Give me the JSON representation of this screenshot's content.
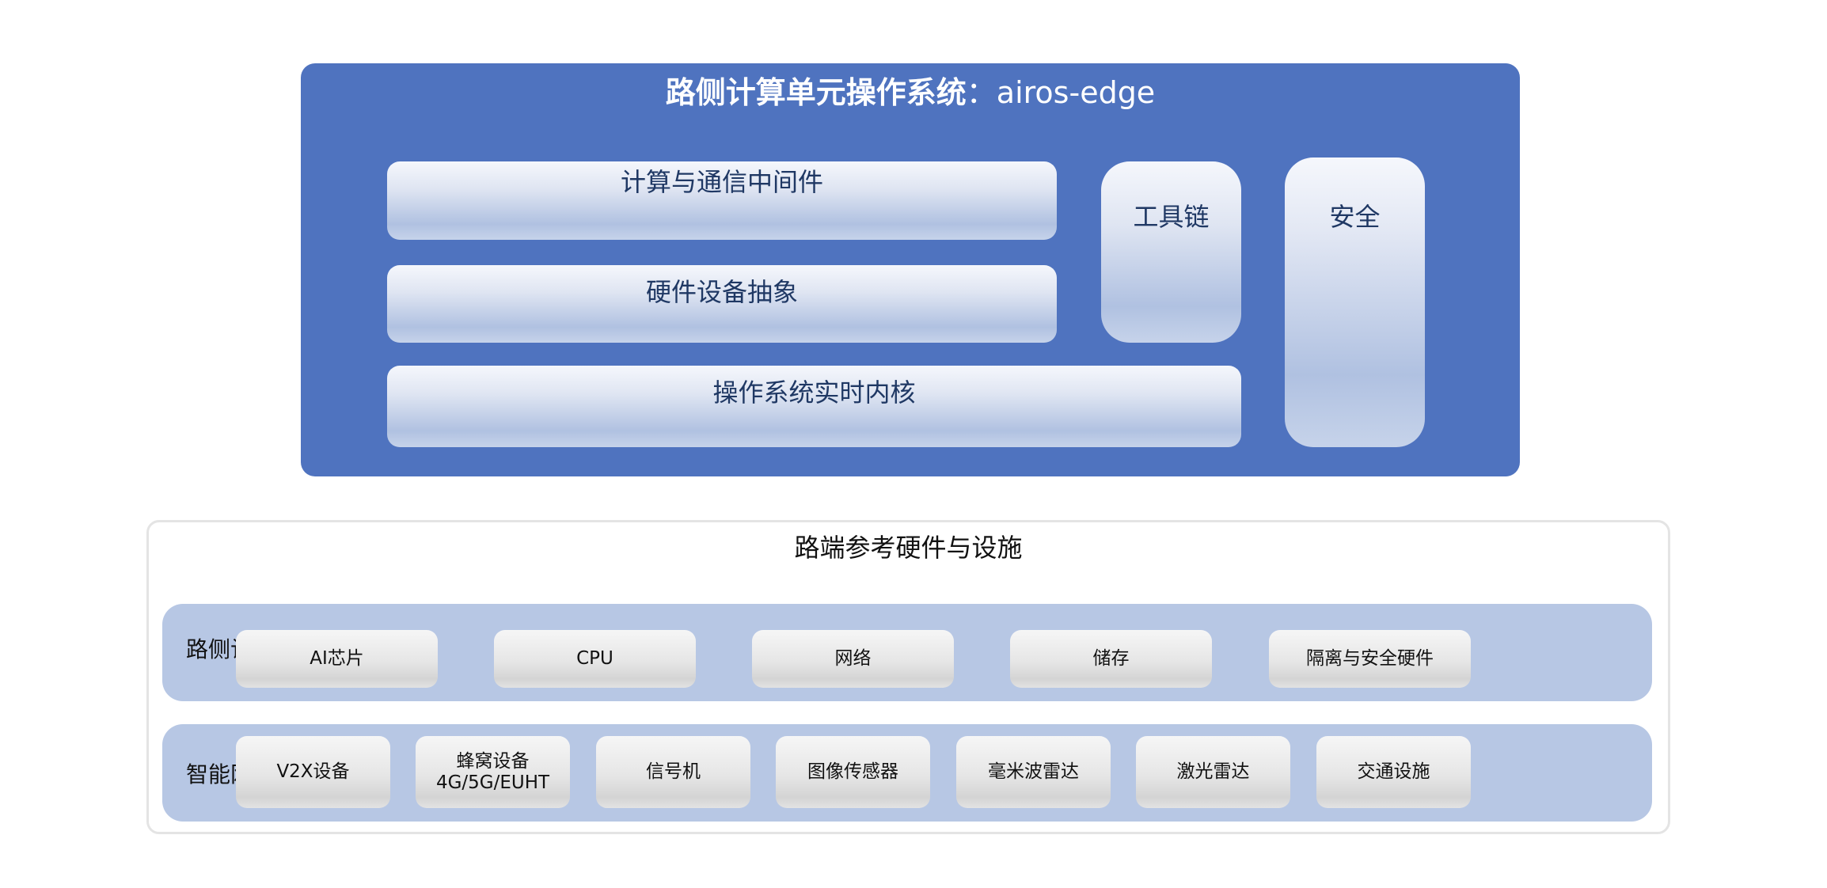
{
  "os": {
    "title_bold": "路侧计算单元操作系统",
    "title_rest": "：airos-edge",
    "colors": {
      "panel": "#4f73bf",
      "text": "#1f3864"
    },
    "modules": {
      "middleware": "计算与通信中间件",
      "hw_abstraction": "硬件设备抽象",
      "kernel": "操作系统实时内核",
      "toolchain": "工具链",
      "security": "安全"
    }
  },
  "hardware": {
    "title": "路端参考硬件与设施",
    "colors": {
      "row": "#b7c7e4",
      "border": "#e4e4e4"
    },
    "rows": [
      {
        "label": "路侧计算单元",
        "items": [
          "AI芯片",
          "CPU",
          "网络",
          "储存",
          "隔离与安全硬件"
        ]
      },
      {
        "label": "智能网联设备",
        "items": [
          "V2X设备",
          "蜂窝设备\n4G/5G/EUHT",
          "信号机",
          "图像传感器",
          "毫米波雷达",
          "激光雷达",
          "交通设施"
        ]
      }
    ]
  }
}
